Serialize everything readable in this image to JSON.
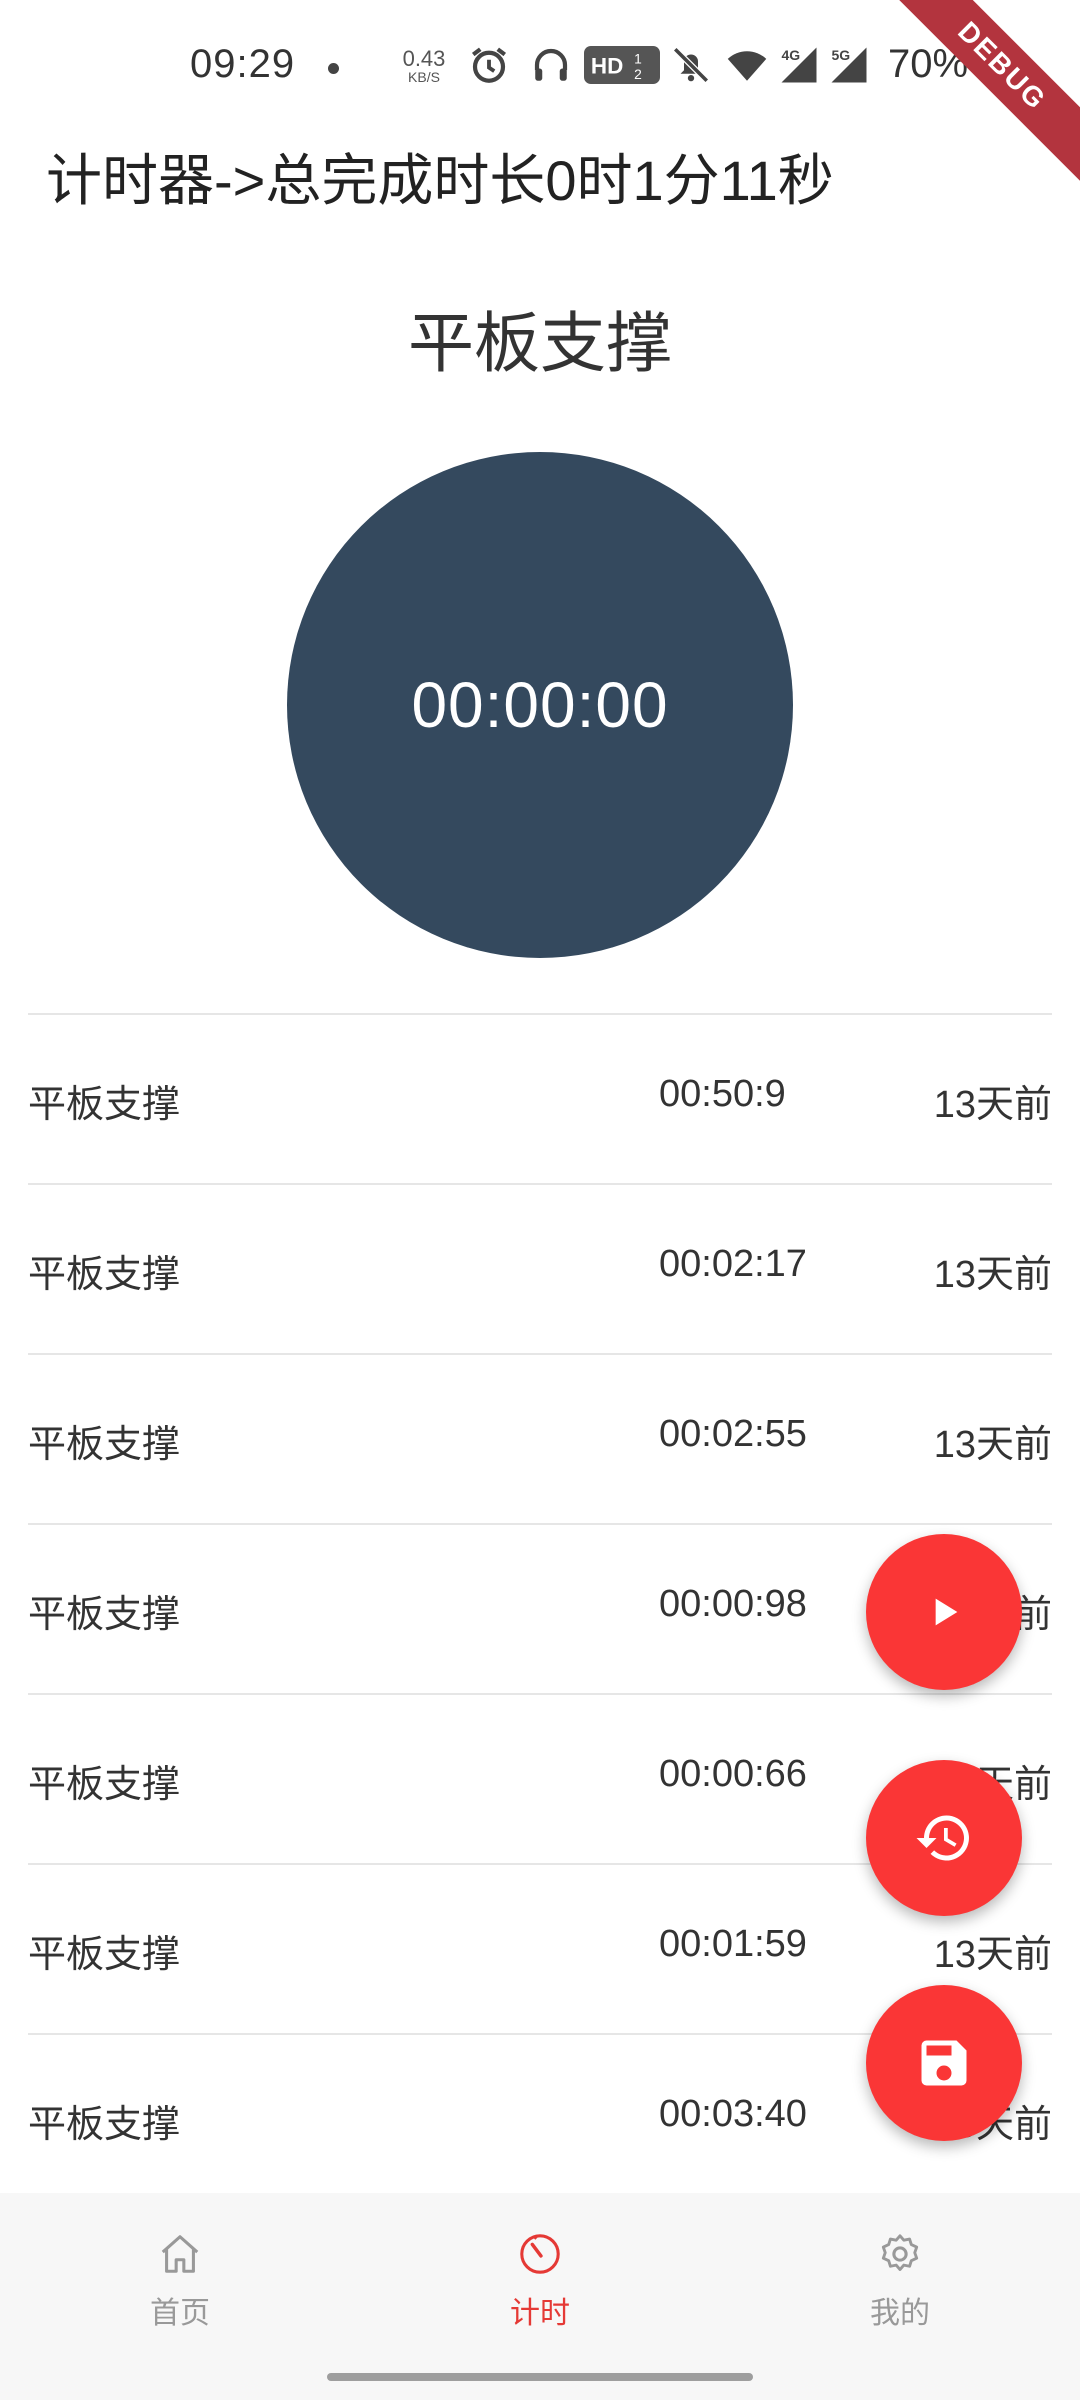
{
  "status_bar": {
    "time": "09:29",
    "net_speed_value": "0.43",
    "net_speed_unit": "KB/S",
    "battery": "70%",
    "icons": [
      "alarm-icon",
      "headphones-icon",
      "hd-icon",
      "bell-off-icon",
      "wifi-icon",
      "signal-4g-icon",
      "signal-5g-icon",
      "battery-icon"
    ],
    "debug_label": "DEBUG"
  },
  "header": {
    "title": "计时器->总完成时长0时1分11秒"
  },
  "timer": {
    "exercise_name": "平板支撑",
    "display": "00:00:00",
    "circle_color": "#34495e"
  },
  "records": [
    {
      "name": "平板支撑",
      "duration": "00:50:9",
      "ago": "13天前"
    },
    {
      "name": "平板支撑",
      "duration": "00:02:17",
      "ago": "13天前"
    },
    {
      "name": "平板支撑",
      "duration": "00:02:55",
      "ago": "13天前"
    },
    {
      "name": "平板支撑",
      "duration": "00:00:98",
      "ago": "13天前"
    },
    {
      "name": "平板支撑",
      "duration": "00:00:66",
      "ago": "13天前"
    },
    {
      "name": "平板支撑",
      "duration": "00:01:59",
      "ago": "13天前"
    },
    {
      "name": "平板支撑",
      "duration": "00:03:40",
      "ago": "13天前"
    }
  ],
  "fabs": {
    "accent": "#fa3636",
    "buttons": [
      "play-icon",
      "history-icon",
      "save-icon"
    ]
  },
  "bottom_nav": {
    "active_color": "#e53935",
    "items": [
      {
        "label": "首页",
        "icon": "home-icon"
      },
      {
        "label": "计时",
        "icon": "timer-icon",
        "active": true
      },
      {
        "label": "我的",
        "icon": "gear-icon"
      }
    ]
  }
}
